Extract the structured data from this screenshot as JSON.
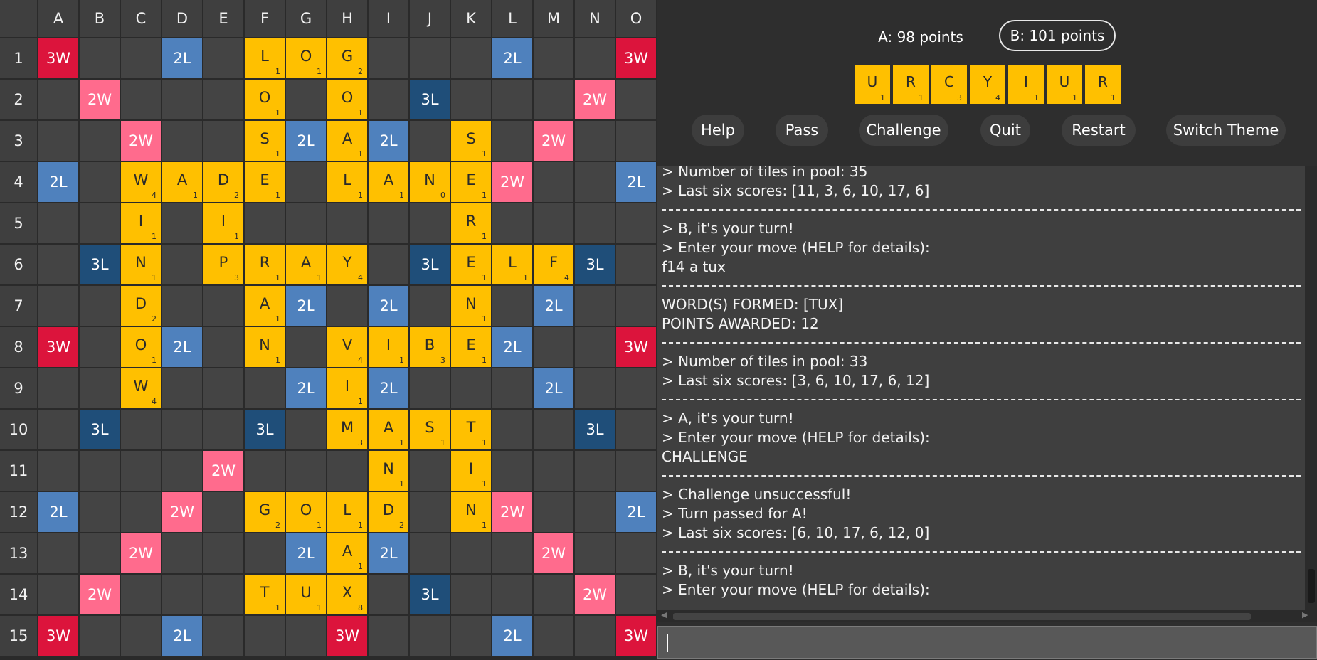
{
  "board": {
    "columns": [
      "A",
      "B",
      "C",
      "D",
      "E",
      "F",
      "G",
      "H",
      "I",
      "J",
      "K",
      "L",
      "M",
      "N",
      "O"
    ],
    "rows": [
      "1",
      "2",
      "3",
      "4",
      "5",
      "6",
      "7",
      "8",
      "9",
      "10",
      "11",
      "12",
      "13",
      "14",
      "15"
    ],
    "premium_colors": {
      "3W": "#dc143c",
      "2W": "#ff6b8d",
      "2L": "#4f81bd",
      "3L": "#1f4e79",
      "tile": "#ffc000"
    },
    "premiums": [
      [
        "3W",
        "",
        "",
        "2L",
        "",
        "",
        "",
        "",
        "",
        "",
        "",
        "2L",
        "",
        "",
        "3W"
      ],
      [
        "",
        "2W",
        "",
        "",
        "",
        "",
        "",
        "",
        "",
        "3L",
        "",
        "",
        "",
        "2W",
        ""
      ],
      [
        "",
        "",
        "2W",
        "",
        "",
        "",
        "2L",
        "",
        "2L",
        "",
        "",
        "",
        "2W",
        "",
        ""
      ],
      [
        "2L",
        "",
        "",
        "",
        "",
        "",
        "",
        "",
        "",
        "",
        "",
        "2W",
        "",
        "",
        "2L"
      ],
      [
        "",
        "",
        "",
        "",
        "",
        "",
        "",
        "",
        "",
        "",
        "",
        "",
        "",
        "",
        ""
      ],
      [
        "",
        "3L",
        "",
        "",
        "",
        "",
        "",
        "",
        "",
        "3L",
        "",
        "",
        "",
        "3L",
        ""
      ],
      [
        "",
        "",
        "",
        "",
        "",
        "",
        "2L",
        "",
        "2L",
        "",
        "",
        "",
        "2L",
        "",
        ""
      ],
      [
        "3W",
        "",
        "",
        "2L",
        "",
        "",
        "",
        "",
        "",
        "",
        "",
        "2L",
        "",
        "",
        "3W"
      ],
      [
        "",
        "",
        "",
        "",
        "",
        "",
        "2L",
        "",
        "2L",
        "",
        "",
        "",
        "2L",
        "",
        ""
      ],
      [
        "",
        "3L",
        "",
        "",
        "",
        "3L",
        "",
        "",
        "",
        "",
        "",
        "",
        "",
        "3L",
        ""
      ],
      [
        "",
        "",
        "",
        "",
        "2W",
        "",
        "",
        "",
        "",
        "",
        "",
        "",
        "",
        "",
        ""
      ],
      [
        "2L",
        "",
        "",
        "2W",
        "",
        "",
        "",
        "",
        "",
        "",
        "",
        "2W",
        "",
        "",
        "2L"
      ],
      [
        "",
        "",
        "2W",
        "",
        "",
        "",
        "2L",
        "",
        "2L",
        "",
        "",
        "",
        "2W",
        "",
        ""
      ],
      [
        "",
        "2W",
        "",
        "",
        "",
        "",
        "",
        "",
        "",
        "3L",
        "",
        "",
        "",
        "2W",
        ""
      ],
      [
        "3W",
        "",
        "",
        "2L",
        "",
        "",
        "",
        "3W",
        "",
        "",
        "",
        "2L",
        "",
        "",
        "3W"
      ]
    ],
    "tiles": [
      {
        "r": 1,
        "c": 6,
        "l": "L",
        "p": "1"
      },
      {
        "r": 1,
        "c": 7,
        "l": "O",
        "p": "1"
      },
      {
        "r": 1,
        "c": 8,
        "l": "G",
        "p": "2"
      },
      {
        "r": 2,
        "c": 6,
        "l": "O",
        "p": "1"
      },
      {
        "r": 2,
        "c": 8,
        "l": "O",
        "p": "1"
      },
      {
        "r": 3,
        "c": 6,
        "l": "S",
        "p": "1"
      },
      {
        "r": 3,
        "c": 8,
        "l": "A",
        "p": "1"
      },
      {
        "r": 3,
        "c": 11,
        "l": "S",
        "p": "1"
      },
      {
        "r": 4,
        "c": 3,
        "l": "W",
        "p": "4"
      },
      {
        "r": 4,
        "c": 4,
        "l": "A",
        "p": "1"
      },
      {
        "r": 4,
        "c": 5,
        "l": "D",
        "p": "2"
      },
      {
        "r": 4,
        "c": 6,
        "l": "E",
        "p": "1"
      },
      {
        "r": 4,
        "c": 8,
        "l": "L",
        "p": "1"
      },
      {
        "r": 4,
        "c": 9,
        "l": "A",
        "p": "1"
      },
      {
        "r": 4,
        "c": 10,
        "l": "N",
        "p": "0"
      },
      {
        "r": 4,
        "c": 11,
        "l": "E",
        "p": "1"
      },
      {
        "r": 5,
        "c": 3,
        "l": "I",
        "p": "1"
      },
      {
        "r": 5,
        "c": 5,
        "l": "I",
        "p": "1"
      },
      {
        "r": 5,
        "c": 11,
        "l": "R",
        "p": "1"
      },
      {
        "r": 6,
        "c": 3,
        "l": "N",
        "p": "1"
      },
      {
        "r": 6,
        "c": 5,
        "l": "P",
        "p": "3"
      },
      {
        "r": 6,
        "c": 6,
        "l": "R",
        "p": "1"
      },
      {
        "r": 6,
        "c": 7,
        "l": "A",
        "p": "1"
      },
      {
        "r": 6,
        "c": 8,
        "l": "Y",
        "p": "4"
      },
      {
        "r": 6,
        "c": 11,
        "l": "E",
        "p": "1"
      },
      {
        "r": 6,
        "c": 12,
        "l": "L",
        "p": "1"
      },
      {
        "r": 6,
        "c": 13,
        "l": "F",
        "p": "4"
      },
      {
        "r": 7,
        "c": 3,
        "l": "D",
        "p": "2"
      },
      {
        "r": 7,
        "c": 6,
        "l": "A",
        "p": "1"
      },
      {
        "r": 7,
        "c": 11,
        "l": "N",
        "p": "1"
      },
      {
        "r": 8,
        "c": 3,
        "l": "O",
        "p": "1"
      },
      {
        "r": 8,
        "c": 6,
        "l": "N",
        "p": "1"
      },
      {
        "r": 8,
        "c": 8,
        "l": "V",
        "p": "4"
      },
      {
        "r": 8,
        "c": 9,
        "l": "I",
        "p": "1"
      },
      {
        "r": 8,
        "c": 10,
        "l": "B",
        "p": "3"
      },
      {
        "r": 8,
        "c": 11,
        "l": "E",
        "p": "1"
      },
      {
        "r": 9,
        "c": 3,
        "l": "W",
        "p": "4"
      },
      {
        "r": 9,
        "c": 8,
        "l": "I",
        "p": "1"
      },
      {
        "r": 10,
        "c": 8,
        "l": "M",
        "p": "3"
      },
      {
        "r": 10,
        "c": 9,
        "l": "A",
        "p": "1"
      },
      {
        "r": 10,
        "c": 10,
        "l": "S",
        "p": "1"
      },
      {
        "r": 10,
        "c": 11,
        "l": "T",
        "p": "1"
      },
      {
        "r": 11,
        "c": 9,
        "l": "N",
        "p": "1"
      },
      {
        "r": 11,
        "c": 11,
        "l": "I",
        "p": "1"
      },
      {
        "r": 12,
        "c": 6,
        "l": "G",
        "p": "2"
      },
      {
        "r": 12,
        "c": 7,
        "l": "O",
        "p": "1"
      },
      {
        "r": 12,
        "c": 8,
        "l": "L",
        "p": "1"
      },
      {
        "r": 12,
        "c": 9,
        "l": "D",
        "p": "2"
      },
      {
        "r": 12,
        "c": 11,
        "l": "N",
        "p": "1"
      },
      {
        "r": 13,
        "c": 8,
        "l": "A",
        "p": "1"
      },
      {
        "r": 14,
        "c": 6,
        "l": "T",
        "p": "1"
      },
      {
        "r": 14,
        "c": 7,
        "l": "U",
        "p": "1"
      },
      {
        "r": 14,
        "c": 8,
        "l": "X",
        "p": "8"
      }
    ]
  },
  "scores": {
    "a": "A: 98 points",
    "b": "B: 101 points",
    "active": "B"
  },
  "rack": [
    {
      "l": "U",
      "p": "1"
    },
    {
      "l": "R",
      "p": "1"
    },
    {
      "l": "C",
      "p": "3"
    },
    {
      "l": "Y",
      "p": "4"
    },
    {
      "l": "I",
      "p": "1"
    },
    {
      "l": "U",
      "p": "1"
    },
    {
      "l": "R",
      "p": "1"
    }
  ],
  "buttons": {
    "help": "Help",
    "pass": "Pass",
    "challenge": "Challenge",
    "quit": "Quit",
    "restart": "Restart",
    "switch_theme": "Switch Theme"
  },
  "console": [
    {
      "t": "line",
      "text": "> Number of tiles in pool: 35"
    },
    {
      "t": "line",
      "text": "> Last six scores: [11, 3, 6, 10, 17, 6]"
    },
    {
      "t": "sep"
    },
    {
      "t": "line",
      "text": "> B, it's your turn!"
    },
    {
      "t": "line",
      "text": "> Enter your move (HELP for details):"
    },
    {
      "t": "line",
      "text": "f14 a tux"
    },
    {
      "t": "sep"
    },
    {
      "t": "line",
      "text": "WORD(S) FORMED: [TUX]"
    },
    {
      "t": "line",
      "text": "POINTS AWARDED: 12"
    },
    {
      "t": "sep"
    },
    {
      "t": "line",
      "text": "> Number of tiles in pool: 33"
    },
    {
      "t": "line",
      "text": "> Last six scores: [3, 6, 10, 17, 6, 12]"
    },
    {
      "t": "sep"
    },
    {
      "t": "line",
      "text": "> A, it's your turn!"
    },
    {
      "t": "line",
      "text": "> Enter your move (HELP for details):"
    },
    {
      "t": "line",
      "text": "CHALLENGE"
    },
    {
      "t": "sep"
    },
    {
      "t": "line",
      "text": "> Challenge unsuccessful!"
    },
    {
      "t": "line",
      "text": "> Turn passed for A!"
    },
    {
      "t": "line",
      "text": "> Last six scores: [6, 10, 17, 6, 12, 0]"
    },
    {
      "t": "sep"
    },
    {
      "t": "line",
      "text": "> B, it's your turn!"
    },
    {
      "t": "line",
      "text": "> Enter your move (HELP for details):"
    }
  ],
  "command_input": {
    "value": "",
    "placeholder": ""
  }
}
